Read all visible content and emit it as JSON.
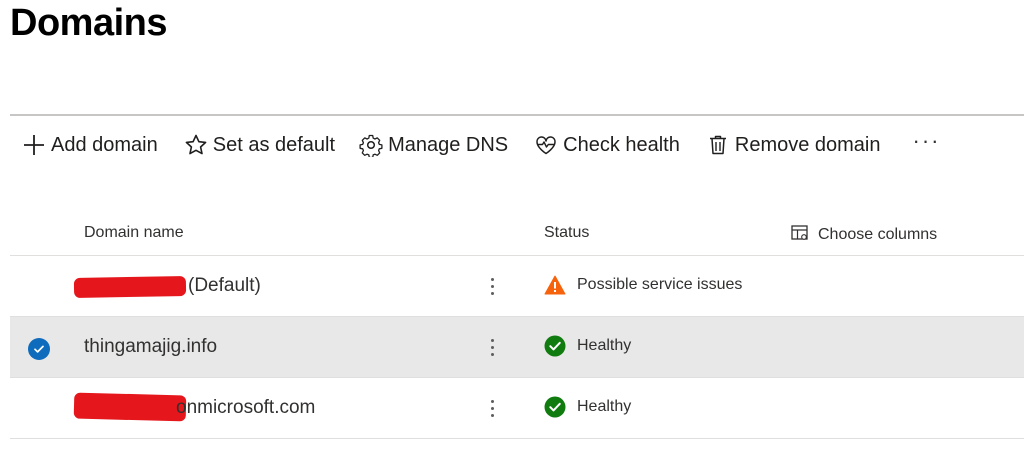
{
  "page": {
    "title": "Domains"
  },
  "toolbar": {
    "add_domain": "Add domain",
    "set_default": "Set as default",
    "manage_dns": "Manage DNS",
    "check_health": "Check health",
    "remove_domain": "Remove domain",
    "more": "···"
  },
  "table": {
    "col_domain": "Domain name",
    "col_status": "Status",
    "choose_columns": "Choose columns",
    "rows": [
      {
        "domain": "(Default)",
        "status": "Possible service issues",
        "status_kind": "warning",
        "selected": false
      },
      {
        "domain": "thingamajig.info",
        "status": "Healthy",
        "status_kind": "healthy",
        "selected": true
      },
      {
        "domain": "onmicrosoft.com",
        "status": "Healthy",
        "status_kind": "healthy",
        "selected": false
      }
    ]
  },
  "colors": {
    "warning": "#f7630c",
    "healthy": "#107c10",
    "check_blue": "#0f6cbd",
    "redaction": "#e5171c",
    "selected_row": "#e8e8e8"
  }
}
